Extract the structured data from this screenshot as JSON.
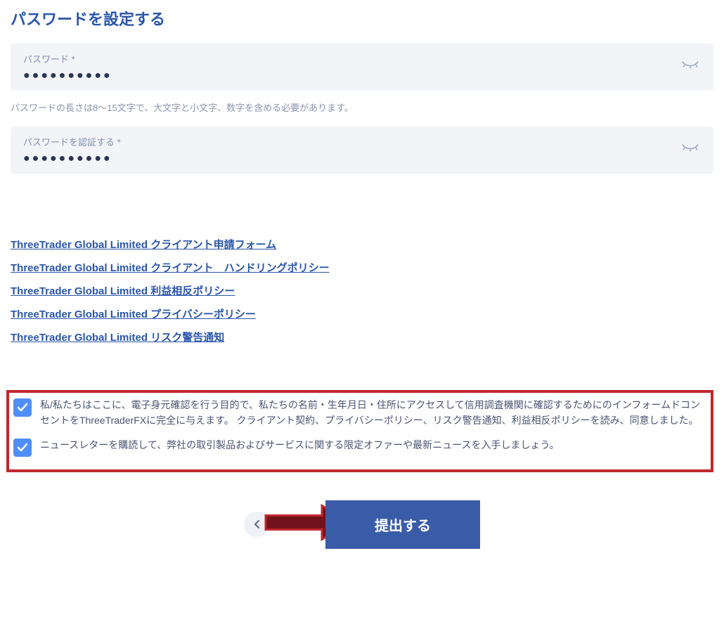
{
  "section": {
    "title": "パスワードを設定する"
  },
  "password": {
    "label": "パスワード *",
    "value": "●●●●●●●●●●",
    "hint": "パスワードの長さは8～15文字で、大文字と小文字、数字を含める必要があります。"
  },
  "confirmPassword": {
    "label": "パスワードを認証する *",
    "value": "●●●●●●●●●●"
  },
  "links": {
    "applicationForm": "ThreeTrader Global Limited クライアント申請フォーム",
    "handlingPolicy": "ThreeTrader Global Limited クライアント　ハンドリングポリシー",
    "conflictPolicy": "ThreeTrader Global Limited 利益相反ポリシー",
    "privacyPolicy": "ThreeTrader Global Limited プライバシーポリシー",
    "riskNotice": "ThreeTrader Global Limited リスク警告通知"
  },
  "consent": {
    "terms": "私/私たちはここに、電子身元確認を行う目的で、私たちの名前・生年月日・住所にアクセスして信用調査機関に確認するためにのインフォームドコンセントをThreeTraderFXに完全に与えます。 クライアント契約、プライバシーポリシー、リスク警告通知、利益相反ポリシーを読み、同意しました。",
    "newsletter": "ニュースレターを購読して、弊社の取引製品およびサービスに関する限定オファーや最新ニュースを入手しましょう。"
  },
  "buttons": {
    "back": "バック",
    "submit": "提出する"
  }
}
